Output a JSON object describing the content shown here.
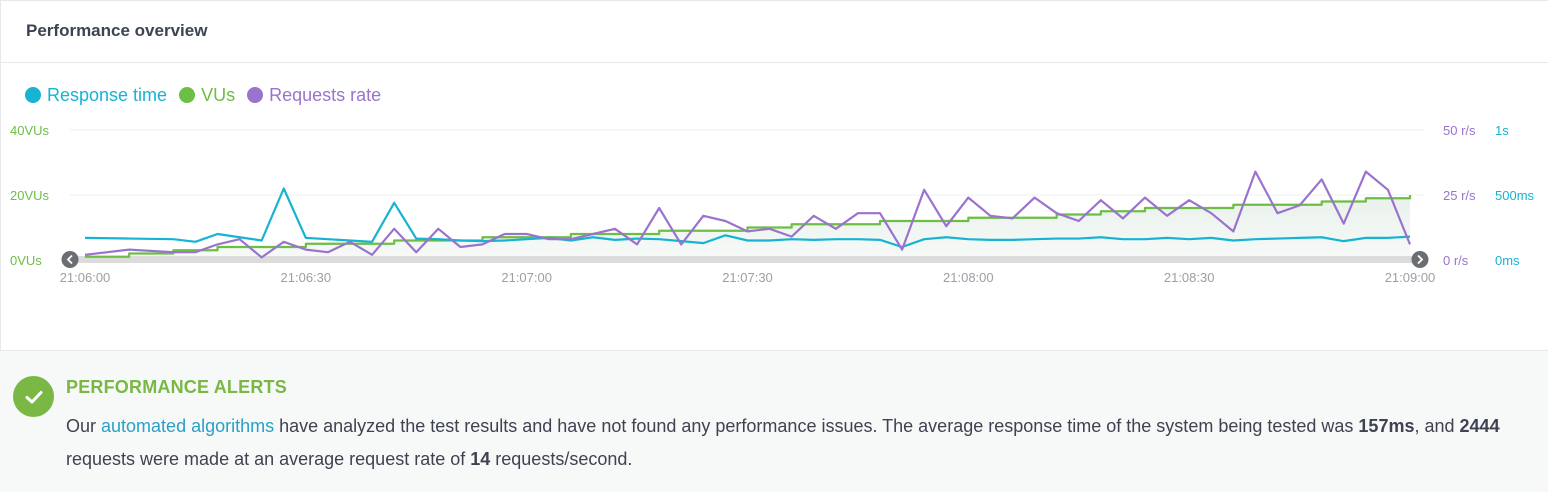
{
  "panel": {
    "title": "Performance overview"
  },
  "legend": [
    {
      "label": "Response time",
      "color": "#16b3d2"
    },
    {
      "label": "VUs",
      "color": "#6cbe45"
    },
    {
      "label": "Requests rate",
      "color": "#9a73cd"
    }
  ],
  "chart_data": {
    "type": "line",
    "title": "",
    "xlabel": "",
    "x_ticks": [
      "21:06:00",
      "21:06:30",
      "21:07:00",
      "21:07:30",
      "21:08:00",
      "21:08:30",
      "21:09:00"
    ],
    "x_range": [
      "21:06:00",
      "21:09:00"
    ],
    "axes": {
      "vus": {
        "ticks": [
          "0VUs",
          "20VUs",
          "40VUs"
        ],
        "range": [
          0,
          40
        ],
        "color": "#6cbe45",
        "position": "left"
      },
      "requests_rate": {
        "ticks": [
          "0 r/s",
          "25 r/s",
          "50 r/s"
        ],
        "range": [
          0,
          50
        ],
        "color": "#9a73cd",
        "position": "right"
      },
      "response_time": {
        "ticks": [
          "0ms",
          "500ms",
          "1s"
        ],
        "range": [
          0,
          1000
        ],
        "color": "#16b3d2",
        "position": "right"
      }
    },
    "grid": true,
    "series": [
      {
        "name": "VUs",
        "axis": "vus",
        "color": "#6cbe45",
        "step": true,
        "fill": true,
        "x": [
          "21:06:00",
          "21:06:06",
          "21:06:12",
          "21:06:18",
          "21:06:24",
          "21:06:30",
          "21:06:36",
          "21:06:42",
          "21:06:48",
          "21:06:54",
          "21:07:00",
          "21:07:06",
          "21:07:12",
          "21:07:18",
          "21:07:24",
          "21:07:30",
          "21:07:36",
          "21:07:42",
          "21:07:48",
          "21:07:54",
          "21:08:00",
          "21:08:06",
          "21:08:12",
          "21:08:18",
          "21:08:24",
          "21:08:30",
          "21:08:36",
          "21:08:42",
          "21:08:48",
          "21:08:54",
          "21:09:00"
        ],
        "values": [
          1,
          2,
          3,
          4,
          4,
          5,
          5,
          6,
          6,
          7,
          7,
          8,
          8,
          9,
          9,
          10,
          11,
          11,
          12,
          12,
          13,
          13,
          14,
          15,
          16,
          16,
          17,
          17,
          18,
          19,
          20
        ]
      },
      {
        "name": "Response time",
        "axis": "response_time",
        "color": "#16b3d2",
        "x": [
          "21:06:00",
          "21:06:06",
          "21:06:12",
          "21:06:15",
          "21:06:18",
          "21:06:21",
          "21:06:24",
          "21:06:27",
          "21:06:30",
          "21:06:33",
          "21:06:36",
          "21:06:39",
          "21:06:42",
          "21:06:45",
          "21:06:48",
          "21:06:51",
          "21:06:54",
          "21:06:57",
          "21:07:00",
          "21:07:03",
          "21:07:06",
          "21:07:09",
          "21:07:12",
          "21:07:15",
          "21:07:18",
          "21:07:21",
          "21:07:24",
          "21:07:27",
          "21:07:30",
          "21:07:33",
          "21:07:36",
          "21:07:39",
          "21:07:42",
          "21:07:45",
          "21:07:48",
          "21:07:51",
          "21:07:54",
          "21:07:57",
          "21:08:00",
          "21:08:03",
          "21:08:06",
          "21:08:09",
          "21:08:12",
          "21:08:15",
          "21:08:18",
          "21:08:21",
          "21:08:24",
          "21:08:27",
          "21:08:30",
          "21:08:33",
          "21:08:36",
          "21:08:39",
          "21:08:42",
          "21:08:45",
          "21:08:48",
          "21:08:51",
          "21:08:54",
          "21:08:57",
          "21:09:00"
        ],
        "values": [
          170,
          165,
          160,
          140,
          200,
          175,
          150,
          550,
          170,
          160,
          150,
          140,
          440,
          165,
          160,
          150,
          145,
          150,
          160,
          170,
          150,
          175,
          155,
          165,
          160,
          145,
          130,
          190,
          150,
          150,
          160,
          155,
          160,
          160,
          155,
          100,
          160,
          175,
          160,
          155,
          155,
          160,
          165,
          165,
          175,
          160,
          160,
          170,
          160,
          170,
          150,
          160,
          165,
          170,
          175,
          145,
          170,
          170,
          180
        ]
      },
      {
        "name": "Requests rate",
        "axis": "requests_rate",
        "color": "#9a73cd",
        "x": [
          "21:06:00",
          "21:06:06",
          "21:06:12",
          "21:06:15",
          "21:06:18",
          "21:06:21",
          "21:06:24",
          "21:06:27",
          "21:06:30",
          "21:06:33",
          "21:06:36",
          "21:06:39",
          "21:06:42",
          "21:06:45",
          "21:06:48",
          "21:06:51",
          "21:06:54",
          "21:06:57",
          "21:07:00",
          "21:07:03",
          "21:07:06",
          "21:07:09",
          "21:07:12",
          "21:07:15",
          "21:07:18",
          "21:07:21",
          "21:07:24",
          "21:07:27",
          "21:07:30",
          "21:07:33",
          "21:07:36",
          "21:07:39",
          "21:07:42",
          "21:07:45",
          "21:07:48",
          "21:07:51",
          "21:07:54",
          "21:07:57",
          "21:08:00",
          "21:08:03",
          "21:08:06",
          "21:08:09",
          "21:08:12",
          "21:08:15",
          "21:08:18",
          "21:08:21",
          "21:08:24",
          "21:08:27",
          "21:08:30",
          "21:08:33",
          "21:08:36",
          "21:08:39",
          "21:08:42",
          "21:08:45",
          "21:08:48",
          "21:08:51",
          "21:08:54",
          "21:08:57",
          "21:09:00"
        ],
        "values": [
          2,
          4,
          3,
          3,
          6,
          8,
          1,
          7,
          4,
          3,
          7,
          2,
          12,
          3,
          12,
          5,
          6,
          10,
          10,
          8,
          8,
          10,
          12,
          6,
          20,
          6,
          17,
          15,
          11,
          12,
          9,
          17,
          12,
          18,
          18,
          4,
          27,
          13,
          24,
          17,
          16,
          24,
          18,
          15,
          23,
          16,
          24,
          17,
          23,
          18,
          11,
          34,
          18,
          21,
          31,
          14,
          34,
          27,
          6
        ]
      }
    ]
  },
  "alert": {
    "title": "PERFORMANCE ALERTS",
    "text_1": "Our ",
    "link": "automated algorithms",
    "text_2": " have analyzed the test results and have not found any performance issues. The average response time of the system being tested was ",
    "avg_response": "157ms",
    "text_3": ", and ",
    "total_requests": "2444",
    "text_4": " requests were made at an average request rate of ",
    "avg_rate": "14",
    "text_5": " requests/second."
  }
}
